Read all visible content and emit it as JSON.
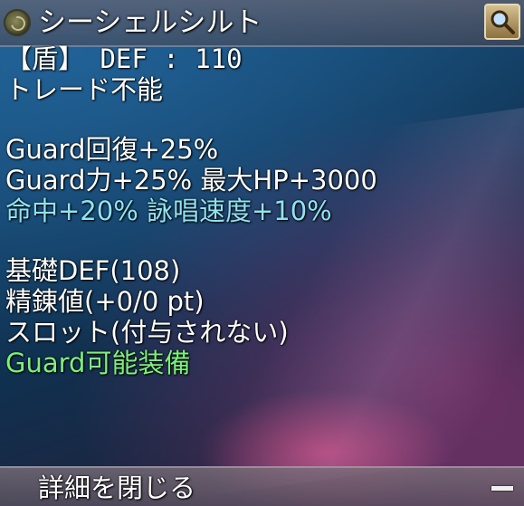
{
  "header": {
    "item_icon": "shield-ring-icon",
    "title": "シーシェルシルト",
    "search_icon": "magnifier-icon"
  },
  "stats": {
    "defense": "【盾】 DEF : 110",
    "trade": "トレード不能",
    "guard_recovery": "Guard回復+25%",
    "guard_power_hp": "Guard力+25% 最大HP+3000",
    "accuracy_cast": "命中+20% 詠唱速度+10%",
    "base_def": "基礎DEF(108)",
    "refine": "精錬値(+0/0 pt)",
    "slot": "スロット(付与されない)",
    "guard_equip": "Guard可能装備"
  },
  "footer": {
    "label": "詳細を閉じる",
    "collapse_icon": "minus-icon"
  },
  "colors": {
    "text": "#ffffff",
    "accent_blue": "#8fe3f0",
    "accent_green": "#7df07a"
  }
}
